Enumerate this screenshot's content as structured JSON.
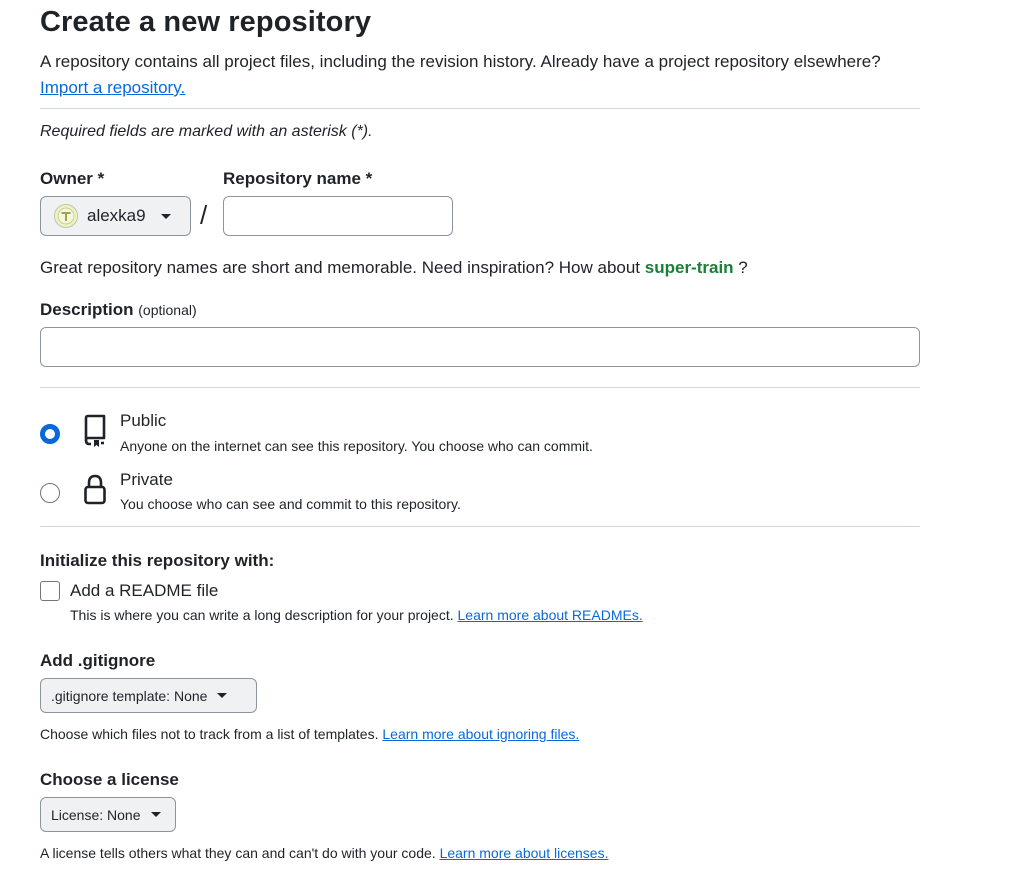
{
  "header": {
    "title": "Create a new repository",
    "subtitle": "A repository contains all project files, including the revision history. Already have a project repository elsewhere?",
    "import_link": "Import a repository."
  },
  "required_note": "Required fields are marked with an asterisk (*).",
  "owner": {
    "label": "Owner *",
    "value": "alexka9"
  },
  "repo_name": {
    "label": "Repository name *",
    "value": "",
    "separator": "/"
  },
  "name_hint": {
    "text": "Great repository names are short and memorable. Need inspiration? How about",
    "suggestion": "super-train",
    "suffix": "?"
  },
  "description": {
    "label": "Description",
    "optional": "(optional)",
    "value": ""
  },
  "visibility": {
    "selected": "public",
    "options": [
      {
        "title": "Public",
        "desc": "Anyone on the internet can see this repository. You choose who can commit."
      },
      {
        "title": "Private",
        "desc": "You choose who can see and commit to this repository."
      }
    ]
  },
  "init": {
    "heading": "Initialize this repository with:",
    "readme": {
      "label": "Add a README file",
      "checked": false,
      "desc": "This is where you can write a long description for your project.",
      "link": "Learn more about READMEs."
    }
  },
  "gitignore": {
    "heading": "Add .gitignore",
    "select_label": ".gitignore template: None",
    "desc": "Choose which files not to track from a list of templates.",
    "link": "Learn more about ignoring files."
  },
  "license": {
    "heading": "Choose a license",
    "select_label": "License: None",
    "desc": "A license tells others what they can and can't do with your code.",
    "link": "Learn more about licenses."
  },
  "colors": {
    "accent": "#0969da",
    "success": "#1a7f37",
    "border": "#d0d7de"
  },
  "icons": {
    "public": "repo-icon",
    "private": "lock-icon"
  }
}
